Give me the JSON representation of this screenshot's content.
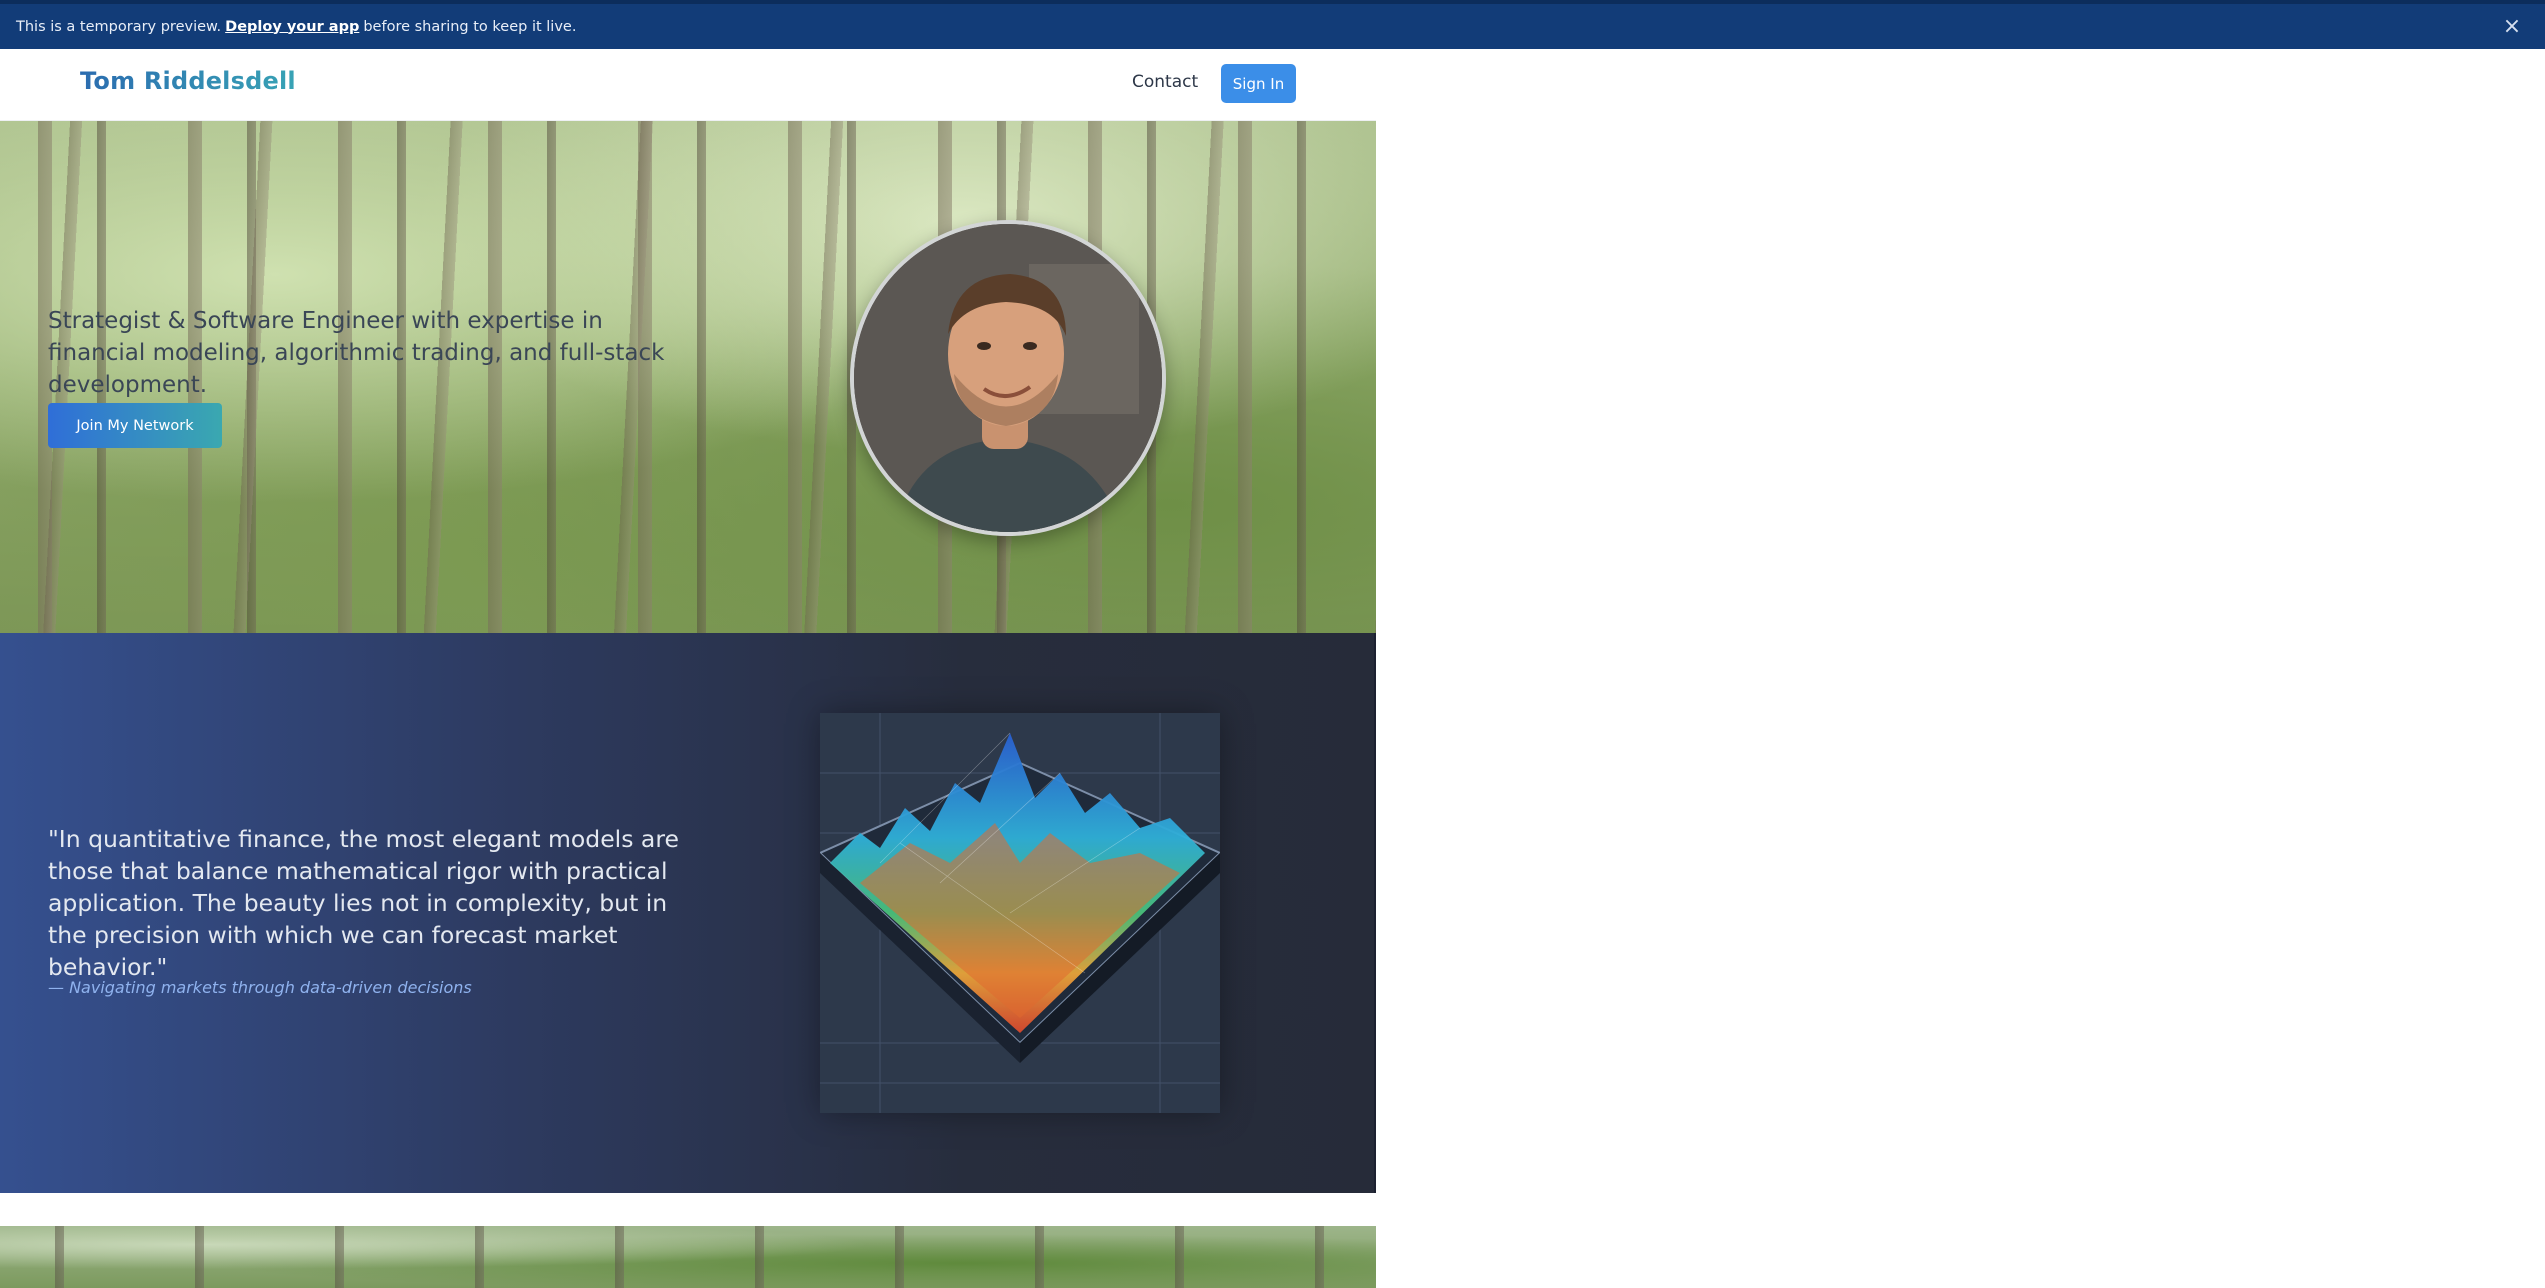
{
  "banner": {
    "prefix": "This is a temporary preview.",
    "link": "Deploy your app",
    "suffix": "before sharing to keep it live.",
    "close_icon": "close-icon"
  },
  "nav": {
    "brand": "Tom Riddelsdell",
    "contact": "Contact",
    "signin": "Sign In"
  },
  "hero": {
    "tagline": "Strategist & Software Engineer with expertise in financial modeling, algorithmic trading, and full-stack development.",
    "cta": "Join My Network",
    "portrait": "profile-photo"
  },
  "quote": {
    "text": "\"In quantitative finance, the most elegant models are those that balance mathematical rigor with practical application. The beauty lies not in complexity, but in the precision with which we can forecast market behavior.\"",
    "attribution": "— Navigating markets through data-driven decisions",
    "visual": "3d-surface-plot-illustration"
  },
  "colors": {
    "banner_bg": "#123c78",
    "brand_start": "#2b6cb0",
    "brand_end": "#38a3b5",
    "signin_bg": "#3b8ee8",
    "quote_attr": "#8fb2ee"
  }
}
